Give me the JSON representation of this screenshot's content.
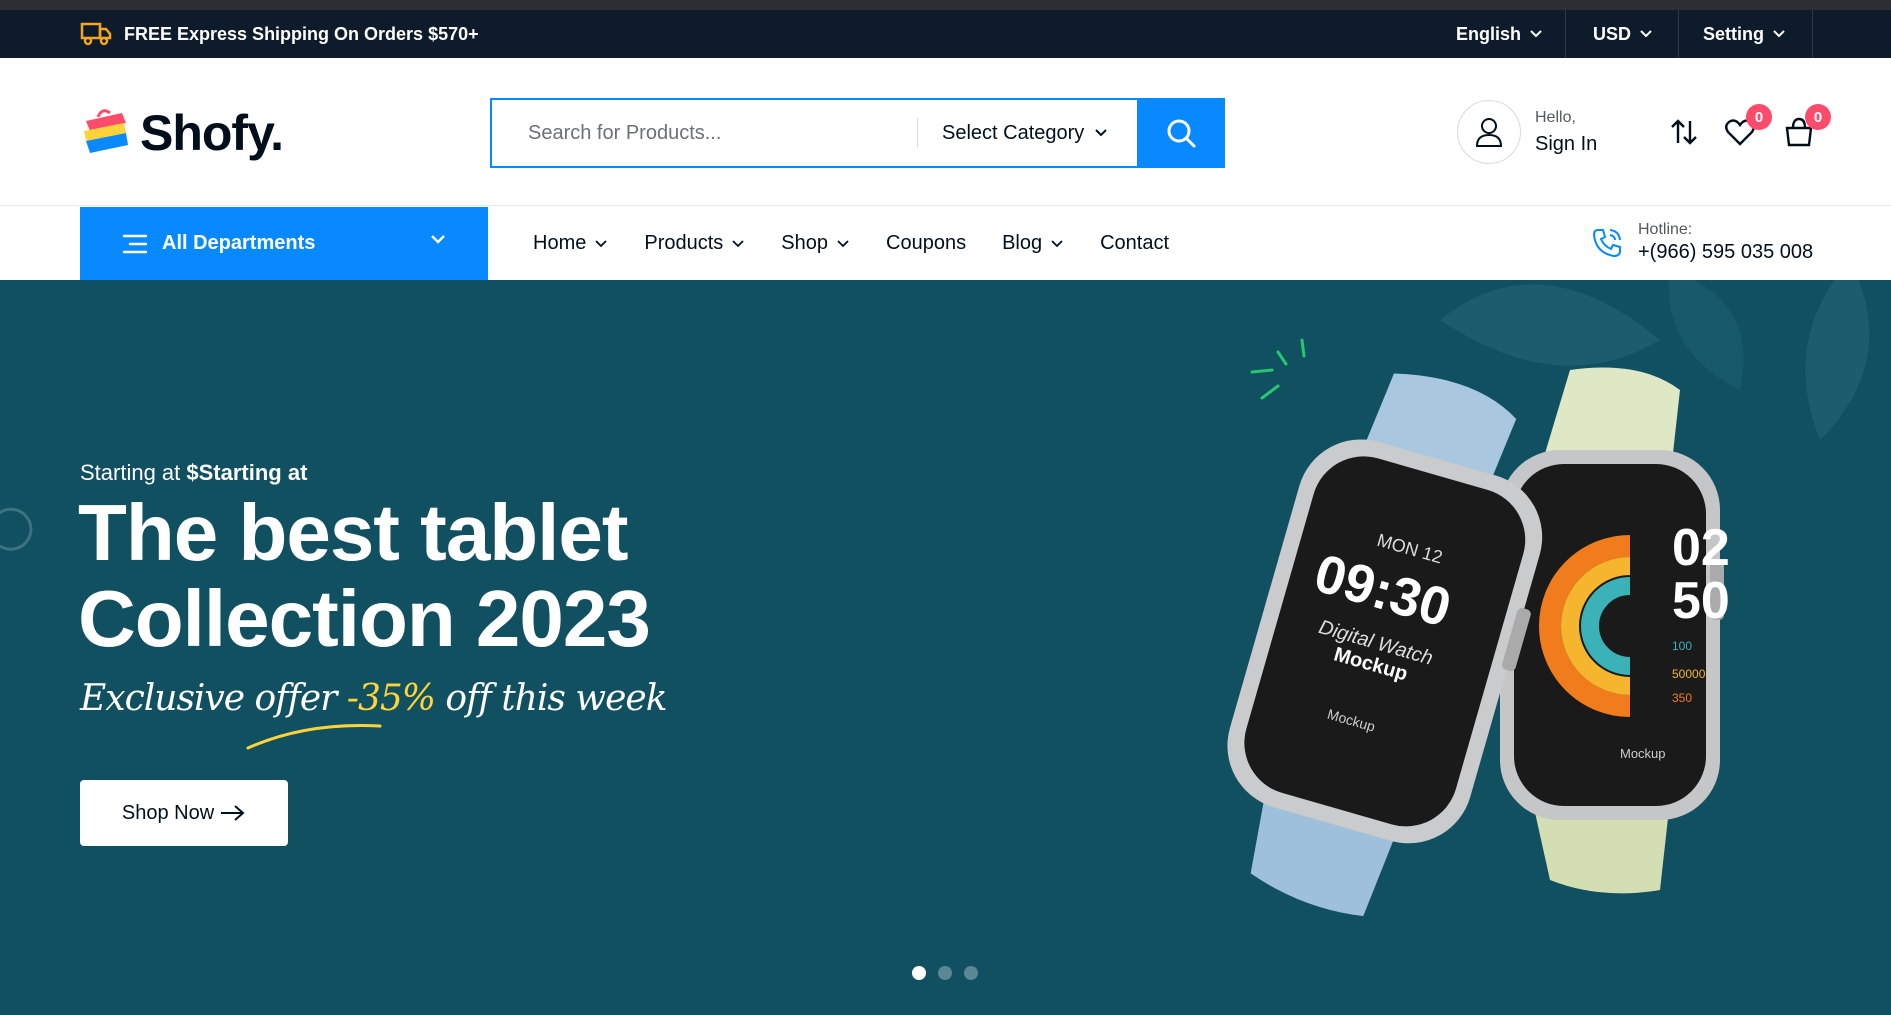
{
  "topbar": {
    "shipping_text": "FREE Express Shipping On Orders $570+",
    "language": "English",
    "currency": "USD",
    "setting": "Setting"
  },
  "header": {
    "logo_text": "Shofy.",
    "search_placeholder": "Search for Products...",
    "category_select": "Select Category",
    "account_hello": "Hello,",
    "account_signin": "Sign In",
    "wishlist_count": "0",
    "cart_count": "0"
  },
  "nav": {
    "departments_label": "All Departments",
    "items": [
      {
        "label": "Home"
      },
      {
        "label": "Products"
      },
      {
        "label": "Shop"
      },
      {
        "label": "Coupons"
      },
      {
        "label": "Blog"
      },
      {
        "label": "Contact"
      }
    ],
    "hotline_label": "Hotline:",
    "hotline_number": "+(966) 595 035 008"
  },
  "hero": {
    "pre_text": "Starting at ",
    "pre_bold": "$Starting at",
    "title_line1": "The best tablet",
    "title_line2": "Collection 2023",
    "offer_before": "Exclusive offer ",
    "offer_pct": "-35%",
    "offer_after": " off this week",
    "button_label": "Shop Now",
    "watch1": {
      "date": "MON 12",
      "time": "09:30",
      "line1": "Digital Watch",
      "line2": "Mockup",
      "brand": "Mockup"
    },
    "watch2": {
      "hour": "02",
      "minute": "50",
      "s1": "100",
      "s2": "50000",
      "s3": "350",
      "brand": "Mockup"
    },
    "slides": 3,
    "active_slide": 1
  },
  "colors": {
    "primary": "#0989ff",
    "topbar_bg": "#0d1b2a",
    "hero_bg": "#115061",
    "badge": "#fd4b6b",
    "accent_yellow": "#ffd43b"
  }
}
